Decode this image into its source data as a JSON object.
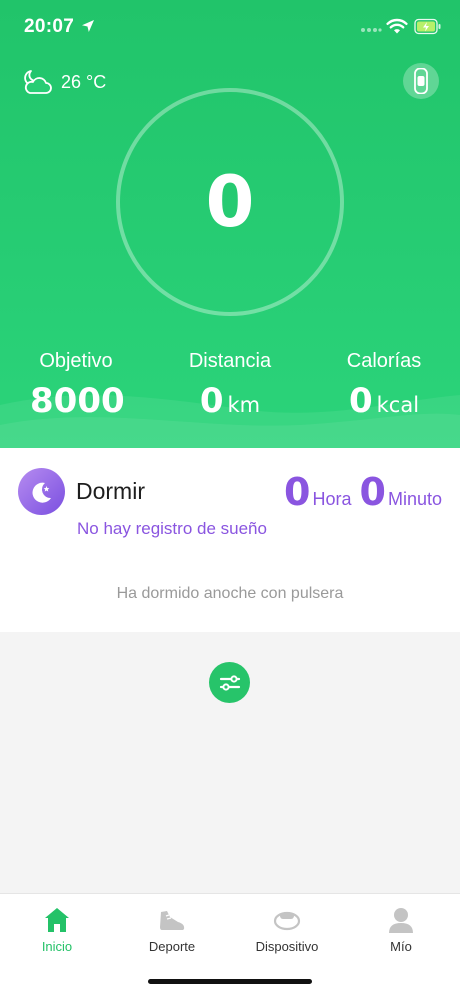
{
  "status_bar": {
    "time": "20:07"
  },
  "weather": {
    "temperature": "26 °C",
    "icon": "cloudy-night-icon"
  },
  "steps": {
    "value": "0"
  },
  "stats": [
    {
      "label": "Objetivo",
      "value": "8000",
      "unit": ""
    },
    {
      "label": "Distancia",
      "value": "0",
      "unit": "km"
    },
    {
      "label": "Calorías",
      "value": "0",
      "unit": "kcal"
    }
  ],
  "sleep": {
    "title": "Dormir",
    "hours": "0",
    "hours_unit": "Hora",
    "minutes": "0",
    "minutes_unit": "Minuto",
    "no_record": "No hay registro de sueño",
    "hint": "Ha dormido anoche con pulsera"
  },
  "tabs": [
    {
      "label": "Inicio",
      "icon": "home-icon",
      "active": true
    },
    {
      "label": "Deporte",
      "icon": "shoe-icon",
      "active": false
    },
    {
      "label": "Dispositivo",
      "icon": "band-icon",
      "active": false
    },
    {
      "label": "Mío",
      "icon": "person-icon",
      "active": false
    }
  ],
  "colors": {
    "brand_green": "#27cd74",
    "sleep_purple": "#8a55e0",
    "active_tab": "#24c268",
    "inactive_icon": "#c4c4c4"
  }
}
